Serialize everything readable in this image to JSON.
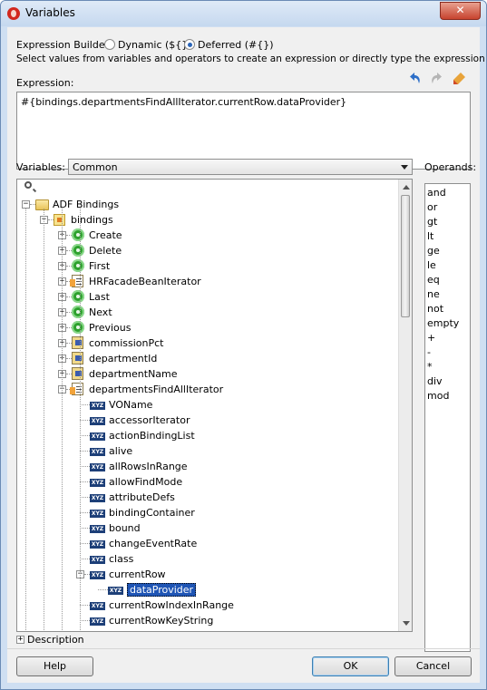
{
  "window": {
    "title": "Variables",
    "close_glyph": "✕"
  },
  "builder": {
    "label": "Expression Builder",
    "mode_dynamic": "Dynamic (${})",
    "mode_deferred": "Deferred (#{})",
    "selected_mode": "Deferred (#{})",
    "instructions": "Select values from variables and operators to create an expression or directly type the expression here:"
  },
  "expression": {
    "label": "Expression:",
    "value": "#{bindings.departmentsFindAllIterator.currentRow.dataProvider}"
  },
  "toolbar": {
    "undo_icon": "undo-icon",
    "redo_icon": "redo-icon",
    "clear_icon": "eraser-icon"
  },
  "variables": {
    "label": "Variables:",
    "selected": "Common",
    "search_placeholder": ""
  },
  "tree": [
    {
      "label": "ADF Bindings",
      "icon": "folder-icon",
      "depth": 0,
      "state": "expanded"
    },
    {
      "label": "bindings",
      "icon": "bindings-icon",
      "depth": 1,
      "state": "expanded"
    },
    {
      "label": "Create",
      "icon": "gear-icon",
      "depth": 2,
      "state": "collapsed"
    },
    {
      "label": "Delete",
      "icon": "gear-icon",
      "depth": 2,
      "state": "collapsed"
    },
    {
      "label": "First",
      "icon": "gear-icon",
      "depth": 2,
      "state": "collapsed"
    },
    {
      "label": "HRFacadeBeanIterator",
      "icon": "iterator-icon",
      "depth": 2,
      "state": "collapsed"
    },
    {
      "label": "Last",
      "icon": "gear-icon",
      "depth": 2,
      "state": "collapsed"
    },
    {
      "label": "Next",
      "icon": "gear-icon",
      "depth": 2,
      "state": "collapsed"
    },
    {
      "label": "Previous",
      "icon": "gear-icon",
      "depth": 2,
      "state": "collapsed"
    },
    {
      "label": "commissionPct",
      "icon": "attribute-icon",
      "depth": 2,
      "state": "collapsed"
    },
    {
      "label": "departmentId",
      "icon": "attribute-icon",
      "depth": 2,
      "state": "collapsed"
    },
    {
      "label": "departmentName",
      "icon": "attribute-icon",
      "depth": 2,
      "state": "collapsed"
    },
    {
      "label": "departmentsFindAllIterator",
      "icon": "iterator-icon",
      "depth": 2,
      "state": "expanded"
    },
    {
      "label": "VOName",
      "icon": "xyz-icon",
      "depth": 3,
      "state": "leaf"
    },
    {
      "label": "accessorIterator",
      "icon": "xyz-icon",
      "depth": 3,
      "state": "leaf"
    },
    {
      "label": "actionBindingList",
      "icon": "xyz-icon",
      "depth": 3,
      "state": "leaf"
    },
    {
      "label": "alive",
      "icon": "xyz-icon",
      "depth": 3,
      "state": "leaf"
    },
    {
      "label": "allRowsInRange",
      "icon": "xyz-icon",
      "depth": 3,
      "state": "leaf"
    },
    {
      "label": "allowFindMode",
      "icon": "xyz-icon",
      "depth": 3,
      "state": "leaf"
    },
    {
      "label": "attributeDefs",
      "icon": "xyz-icon",
      "depth": 3,
      "state": "leaf"
    },
    {
      "label": "bindingContainer",
      "icon": "xyz-icon",
      "depth": 3,
      "state": "leaf"
    },
    {
      "label": "bound",
      "icon": "xyz-icon",
      "depth": 3,
      "state": "leaf"
    },
    {
      "label": "changeEventRate",
      "icon": "xyz-icon",
      "depth": 3,
      "state": "leaf"
    },
    {
      "label": "class",
      "icon": "xyz-icon",
      "depth": 3,
      "state": "leaf"
    },
    {
      "label": "currentRow",
      "icon": "xyz-icon",
      "depth": 3,
      "state": "expanded"
    },
    {
      "label": "dataProvider",
      "icon": "xyz-icon",
      "depth": 4,
      "state": "leaf",
      "selected": true
    },
    {
      "label": "currentRowIndexInRange",
      "icon": "xyz-icon",
      "depth": 3,
      "state": "leaf"
    },
    {
      "label": "currentRowKeyString",
      "icon": "xyz-icon",
      "depth": 3,
      "state": "leaf"
    }
  ],
  "operands": {
    "label": "Operands:",
    "items": [
      "and",
      "or",
      "gt",
      "lt",
      "ge",
      "le",
      "eq",
      "ne",
      "not",
      "empty",
      "+",
      "-",
      "*",
      "div",
      "mod"
    ]
  },
  "description": {
    "label": "Description",
    "state": "collapsed"
  },
  "buttons": {
    "help": "Help",
    "ok": "OK",
    "cancel": "Cancel"
  }
}
